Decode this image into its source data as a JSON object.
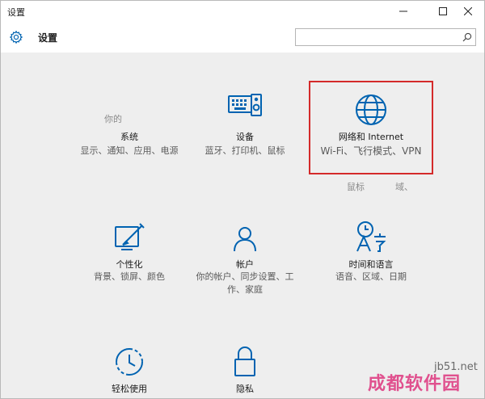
{
  "window": {
    "title": "设置"
  },
  "header": {
    "title": "设置",
    "search_placeholder": ""
  },
  "tiles": [
    {
      "name": "系统",
      "desc": "显示、通知、应用、电源",
      "icon": "laptop-icon"
    },
    {
      "name": "设备",
      "desc": "蓝牙、打印机、鼠标",
      "icon": "devices-icon"
    },
    {
      "name": "网络和 Internet",
      "desc": "Wi-Fi、飞行模式、VPN",
      "icon": "globe-icon"
    },
    {
      "name": "个性化",
      "desc": "背景、锁屏、颜色",
      "icon": "personalization-icon"
    },
    {
      "name": "帐户",
      "desc": "你的帐户、同步设置、工作、家庭",
      "icon": "account-icon"
    },
    {
      "name": "时间和语言",
      "desc": "语音、区域、日期",
      "icon": "time-language-icon"
    },
    {
      "name": "轻松使用",
      "desc": "",
      "icon": "ease-of-access-icon"
    },
    {
      "name": "隐私",
      "desc": "",
      "icon": "lock-icon"
    }
  ],
  "stray_text": {
    "top_left": "你的",
    "under_network": "鼠标",
    "under_network_2": "域、"
  },
  "watermark": {
    "main": "成都软件园",
    "site": "jb51.net"
  },
  "colors": {
    "accent": "#0063b1",
    "highlight_frame": "#d42a2a"
  }
}
